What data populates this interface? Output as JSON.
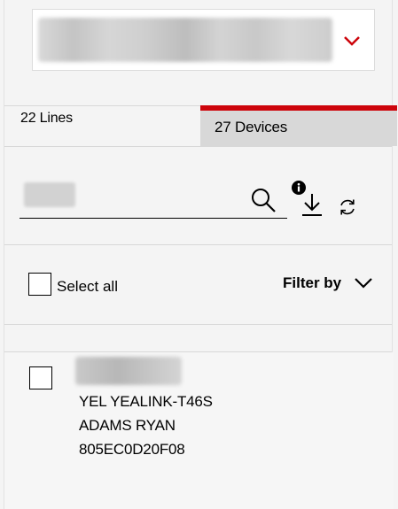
{
  "account_selector": {
    "value": "",
    "icon": "chevron-down-icon",
    "accent": "#cd040b"
  },
  "tabs": [
    {
      "label": "22 Lines",
      "active": false
    },
    {
      "label": "27 Devices",
      "active": true
    }
  ],
  "search": {
    "value": "",
    "icons": [
      "search-icon",
      "info-icon",
      "download-icon",
      "refresh-icon"
    ]
  },
  "list_controls": {
    "select_all_label": "Select all",
    "filter_label": "Filter by"
  },
  "devices": [
    {
      "name": "",
      "model": "YEL YEALINK-T46S",
      "user": "ADAMS RYAN",
      "id": "805EC0D20F08"
    }
  ]
}
